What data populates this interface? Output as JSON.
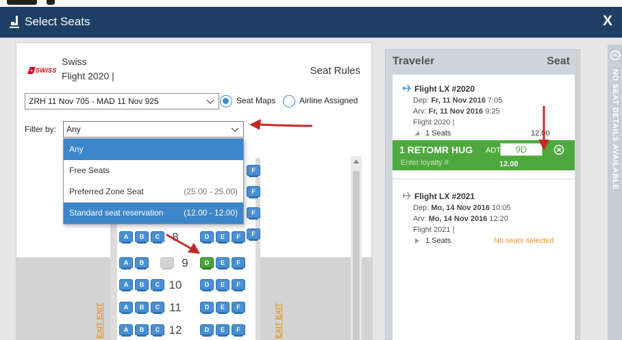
{
  "dialog": {
    "title": "Select Seats",
    "close_label": "X"
  },
  "airline": {
    "logo_text": "SWISS",
    "name": "Swiss",
    "flight": "Flight 2020 |",
    "seat_rules_label": "Seat Rules"
  },
  "route_select": {
    "value": "ZRH 11 Nov 705 - MAD 11 Nov 925"
  },
  "mode": {
    "seat_maps_label": "Seat Maps",
    "airline_assigned_label": "Airline Assigned",
    "selected": "Seat Maps"
  },
  "filter": {
    "label": "Filter by:",
    "value": "Any",
    "options": [
      {
        "label": "Any",
        "price": ""
      },
      {
        "label": "Free Seats",
        "price": ""
      },
      {
        "label": "Preferred Zone Seat",
        "price": "(25.00 - 25.00)"
      },
      {
        "label": "Standard seat reservation",
        "price": "(12.00 - 12.00)"
      }
    ],
    "highlighted": [
      "Any",
      "Standard seat reservation"
    ]
  },
  "seat_map": {
    "exit_label": "EXIT EXIT",
    "partial_seats": [
      "F",
      "F",
      "F",
      "F"
    ],
    "rows": [
      {
        "number": "8",
        "seats": [
          "A",
          "B",
          "C",
          "D",
          "E",
          "F"
        ]
      },
      {
        "number": "9",
        "seats": [
          "A",
          "B",
          "",
          "D",
          "E",
          "F"
        ]
      },
      {
        "number": "10",
        "seats": [
          "A",
          "B",
          "C",
          "D",
          "E",
          "F"
        ]
      },
      {
        "number": "11",
        "seats": [
          "A",
          "B",
          "C",
          "D",
          "E",
          "F"
        ]
      },
      {
        "number": "12",
        "seats": [
          "A",
          "B",
          "C",
          "D",
          "E",
          "F"
        ]
      }
    ],
    "occupied_seat": "9C",
    "selected_seat": "9D",
    "colors": {
      "available": "#4a8fd3",
      "selected": "#4aa53a",
      "occupied": "#d4d4d4"
    }
  },
  "traveler_panel": {
    "traveler_header": "Traveler",
    "seat_header": "Seat",
    "flights": [
      {
        "title": "Flight LX #2020",
        "dep_label": "Dep:",
        "dep_date": "Fr, 11 Nov 2016",
        "dep_time": "7:05",
        "arv_label": "Arv:",
        "arv_date": "Fr, 11 Nov 2016",
        "arv_time": "9:25",
        "flight_no": "Flight 2020 |",
        "seats": "1 Seats",
        "seat_price": "12.00"
      },
      {
        "title": "Flight LX #2021",
        "dep_label": "Dep:",
        "dep_date": "Mo, 14 Nov 2016",
        "dep_time": "10:05",
        "arv_label": "Arv:",
        "arv_date": "Mo, 14 Nov 2016",
        "arv_time": "12:20",
        "flight_no": "Flight 2021 |",
        "seats": "1 Seats",
        "status": "No seats selected"
      }
    ],
    "passenger": {
      "name": "1 RETOMR HUG",
      "type": "ADT",
      "seat": "9D",
      "loyalty_placeholder": "Enter loyalty #",
      "price": "12.00"
    },
    "accent_color": "#4ea83d",
    "status_color": "#f0962e"
  },
  "no_seat_panel": {
    "label": "NO SEAT DETAILS AVAILABLE"
  }
}
